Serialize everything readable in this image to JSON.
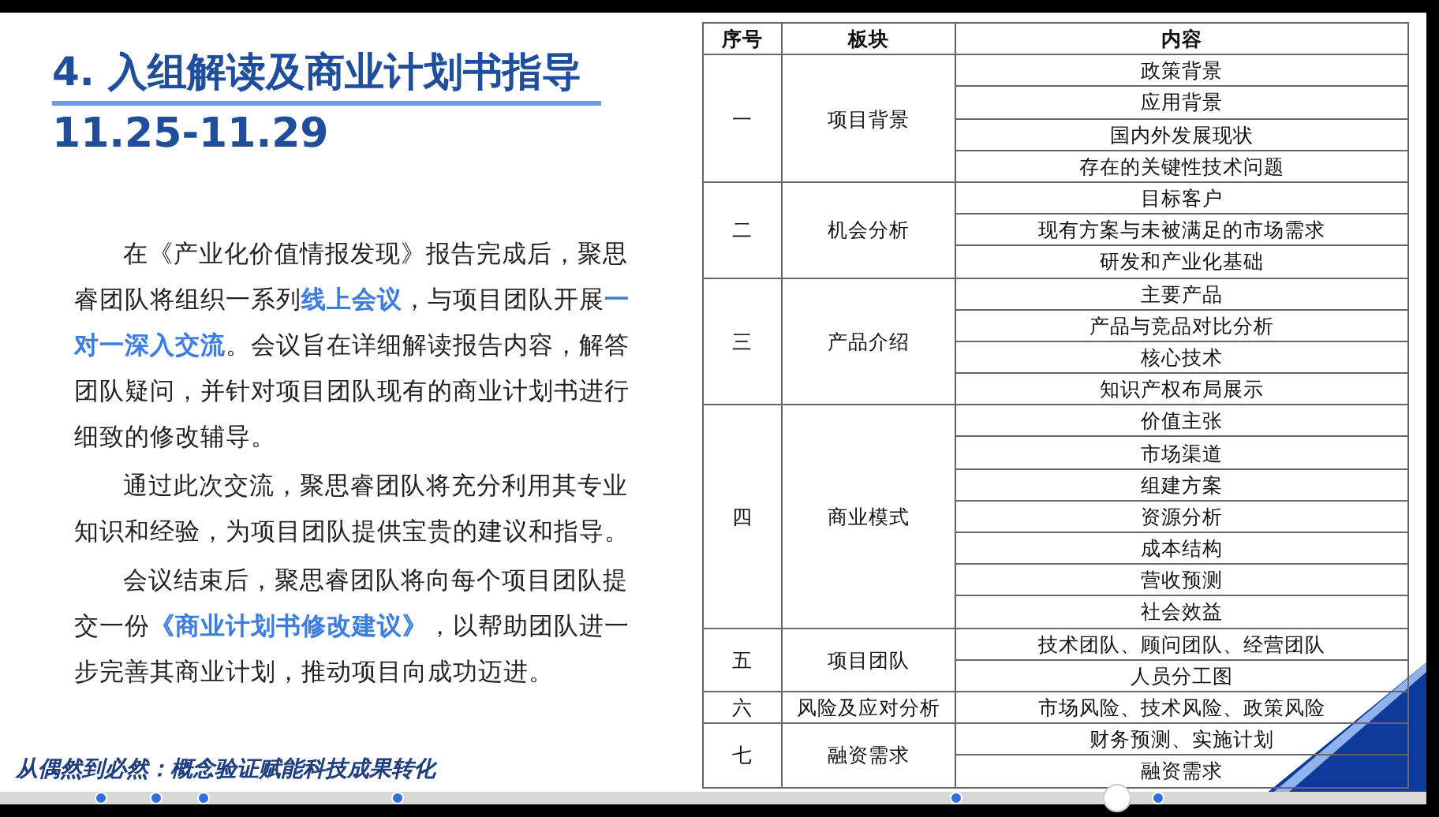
{
  "slide": {
    "title": "4. 入组解读及商业计划书指导",
    "date": "11.25-11.29",
    "paragraphs": [
      "在《产业化价值情报发现》报告完成后，聚思睿团队将组织一系列**线上会议**，与项目团队开展**一对一深入交流**。会议旨在详细解读报告内容，解答团队疑问，并针对项目团队现有的商业计划书进行细致的修改辅导。",
      "通过此次交流，聚思睿团队将充分利用其专业知识和经验，为项目团队提供宝贵的建议和指导。",
      "会议结束后，聚思睿团队将向每个项目团队提交一份**《商业计划书修改建议》**，以帮助团队进一步完善其商业计划，推动项目向成功迈进。"
    ],
    "table": {
      "columns": [
        "序号",
        "板块",
        "内容"
      ],
      "sections": [
        {
          "number": "一",
          "name": "项目背景",
          "items": [
            "政策背景",
            "应用背景",
            "国内外发展现状",
            "存在的关键性技术问题"
          ]
        },
        {
          "number": "二",
          "name": "机会分析",
          "items": [
            "目标客户",
            "现有方案与未被满足的市场需求",
            "研发和产业化基础"
          ]
        },
        {
          "number": "三",
          "name": "产品介绍",
          "items": [
            "主要产品",
            "产品与竞品对比分析",
            "核心技术",
            "知识产权布局展示"
          ]
        },
        {
          "number": "四",
          "name": "商业模式",
          "items": [
            "价值主张",
            "市场渠道",
            "组建方案",
            "资源分析",
            "成本结构",
            "营收预测",
            "社会效益"
          ]
        },
        {
          "number": "五",
          "name": "项目团队",
          "items": [
            "技术团队、顾问团队、经营团队",
            "人员分工图"
          ]
        },
        {
          "number": "六",
          "name": "风险及应对分析",
          "items": [
            "市场风险、技术风险、政策风险"
          ]
        },
        {
          "number": "七",
          "name": "融资需求",
          "items": [
            "财务预测、实施计划",
            "融资需求"
          ]
        }
      ]
    },
    "footer": "从偶然到必然：概念验证赋能科技成果转化"
  },
  "player": {
    "level": 0.776
  }
}
